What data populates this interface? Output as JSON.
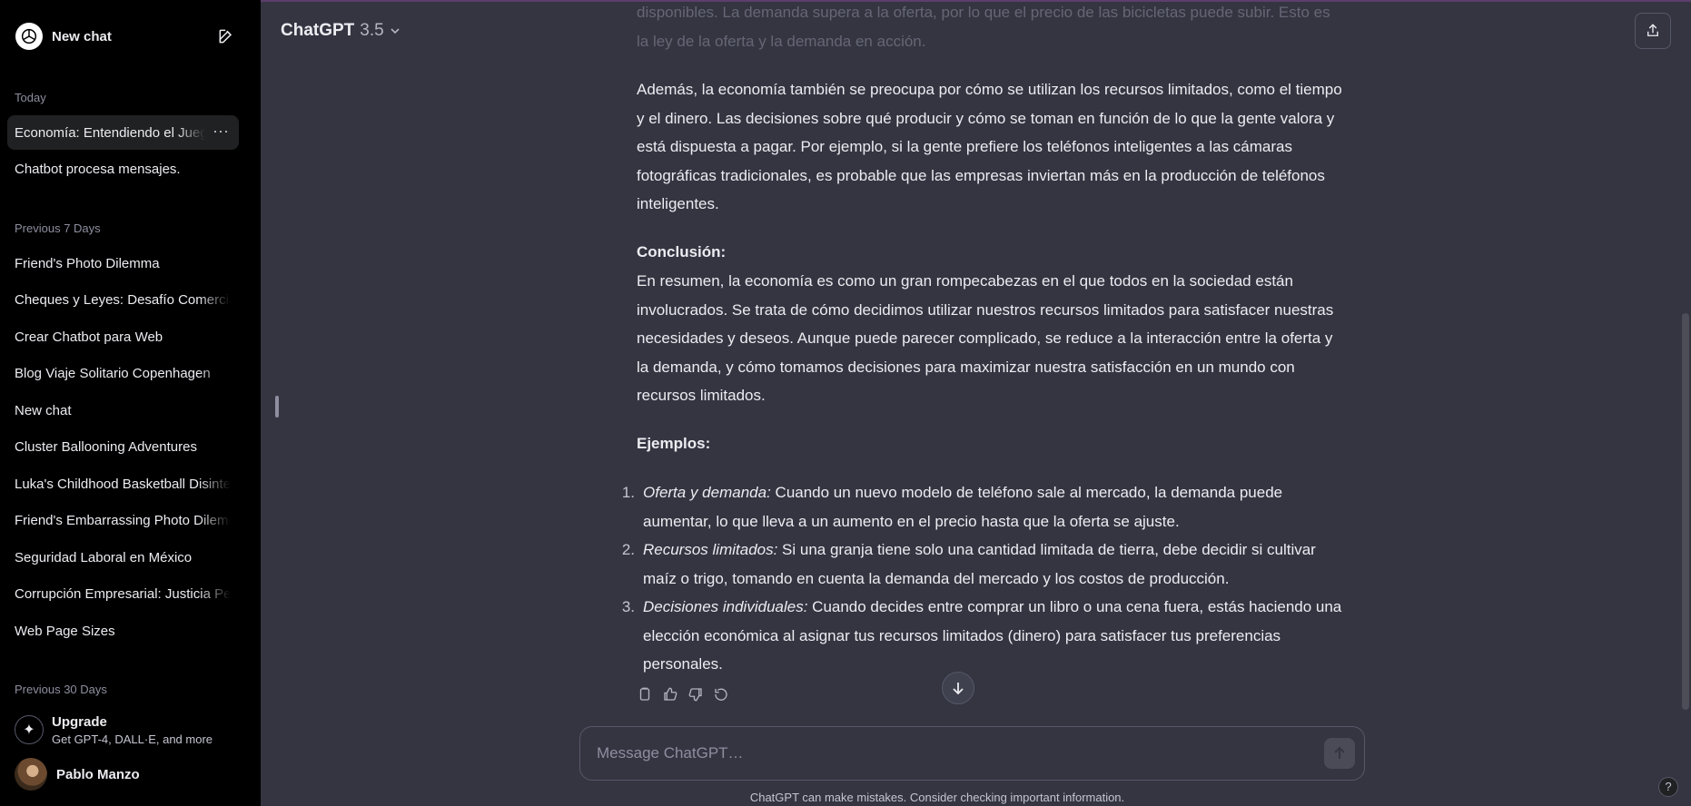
{
  "sidebar": {
    "new_chat": "New chat",
    "sections": {
      "today": "Today",
      "previous_7": "Previous 7 Days",
      "previous_30": "Previous 30 Days"
    },
    "today_items": [
      "Economía: Entendiendo el Juego",
      "Chatbot procesa mensajes."
    ],
    "week_items": [
      "Friend's Photo Dilemma",
      "Cheques y Leyes: Desafío Comercial",
      "Crear Chatbot para Web",
      "Blog Viaje Solitario Copenhagen",
      "New chat",
      "Cluster Ballooning Adventures",
      "Luka's Childhood Basketball Disinterest",
      "Friend's Embarrassing Photo Dilemma",
      "Seguridad Laboral en México",
      "Corrupción Empresarial: Justicia Perdida",
      "Web Page Sizes"
    ],
    "upgrade": {
      "title": "Upgrade",
      "subtitle": "Get GPT-4, DALL·E, and more"
    },
    "user": {
      "name": "Pablo Manzo"
    }
  },
  "header": {
    "model": "ChatGPT",
    "version": "3.5"
  },
  "conversation": {
    "faded_text": "disponibles. La demanda supera a la oferta, por lo que el precio de las bicicletas puede subir. Esto es la ley de la oferta y la demanda en acción.",
    "para1": "Además, la economía también se preocupa por cómo se utilizan los recursos limitados, como el tiempo y el dinero. Las decisiones sobre qué producir y cómo se toman en función de lo que la gente valora y está dispuesta a pagar. Por ejemplo, si la gente prefiere los teléfonos inteligentes a las cámaras fotográficas tradicionales, es probable que las empresas inviertan más en la producción de teléfonos inteligentes.",
    "conclusion_heading": "Conclusión:",
    "conclusion_text": "En resumen, la economía es como un gran rompecabezas en el que todos en la sociedad están involucrados. Se trata de cómo decidimos utilizar nuestros recursos limitados para satisfacer nuestras necesidades y deseos. Aunque puede parecer complicado, se reduce a la interacción entre la oferta y la demanda, y cómo tomamos decisiones para maximizar nuestra satisfacción en un mundo con recursos limitados.",
    "examples_heading": "Ejemplos:",
    "examples": [
      {
        "num": "1.",
        "term": "Oferta y demanda:",
        "text": " Cuando un nuevo modelo de teléfono sale al mercado, la demanda puede aumentar, lo que lleva a un aumento en el precio hasta que la oferta se ajuste."
      },
      {
        "num": "2.",
        "term": "Recursos limitados:",
        "text": " Si una granja tiene solo una cantidad limitada de tierra, debe decidir si cultivar maíz o trigo, tomando en cuenta la demanda del mercado y los costos de producción."
      },
      {
        "num": "3.",
        "term": "Decisiones individuales:",
        "text": " Cuando decides entre comprar un libro o una cena fuera, estás haciendo una elección económica al asignar tus recursos limitados (dinero) para satisfacer tus preferencias personales."
      }
    ]
  },
  "composer": {
    "placeholder": "Message ChatGPT…"
  },
  "footer": {
    "disclaimer": "ChatGPT can make mistakes. Consider checking important information.",
    "help": "?"
  },
  "colors": {
    "sidebar_bg": "#000000",
    "main_bg": "#343541",
    "text": "#ececf1",
    "muted": "#8e8ea0"
  }
}
